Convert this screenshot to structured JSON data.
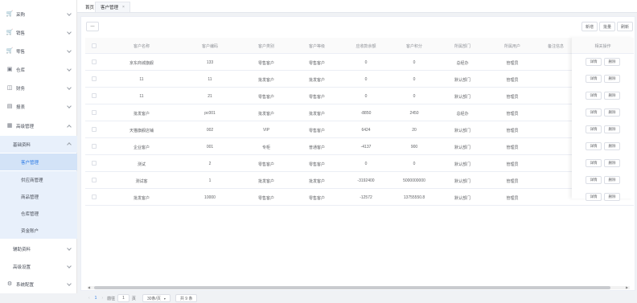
{
  "sidebar": {
    "items": [
      {
        "label": "采购",
        "icon": "cart-icon"
      },
      {
        "label": "销售",
        "icon": "cart-icon"
      },
      {
        "label": "零售",
        "icon": "cart-icon"
      },
      {
        "label": "仓库",
        "icon": "box-icon"
      },
      {
        "label": "财务",
        "icon": "finance-icon"
      },
      {
        "label": "报表",
        "icon": "report-icon"
      },
      {
        "label": "高级管理",
        "icon": "grid-icon"
      }
    ],
    "group": {
      "label": "基础资料"
    },
    "sub_items": [
      "客户管理",
      "供应商管理",
      "商品管理",
      "仓库管理",
      "资金账户"
    ],
    "bottom_items": [
      "辅助资料",
      "高级设置"
    ],
    "system": {
      "label": "系统配置"
    }
  },
  "tabs": {
    "home": "首页",
    "active": "客户管理",
    "close": "×"
  },
  "toolbar": {
    "collapse": "—",
    "add": "新增",
    "batch": "批量",
    "refresh": "刷新"
  },
  "table": {
    "headers": [
      "客户名称",
      "客户编码",
      "客户类别",
      "客户等级",
      "应收款余额",
      "客户积分",
      "所属部门",
      "所属用户",
      "备注信息",
      "相关操作"
    ],
    "rows": [
      [
        "京东商城旗舰",
        "133",
        "零售客户",
        "零售客户",
        "0",
        "0",
        "总经办",
        "管理员"
      ],
      [
        "11",
        "11",
        "批发客户",
        "批发客户",
        "0",
        "0",
        "默认部门",
        "管理员"
      ],
      [
        "11",
        "21",
        "零售客户",
        "零售客户",
        "0",
        "0",
        "默认部门",
        "管理员"
      ],
      [
        "批发客户",
        "pc001",
        "批发客户",
        "批发客户",
        "-8850",
        "2450",
        "总经办",
        "管理员"
      ],
      [
        "天猫旗舰店铺",
        "002",
        "VIP",
        "零售客户",
        "6424",
        "20",
        "默认部门",
        "管理员"
      ],
      [
        "企业客户",
        "001",
        "专柜",
        "普通客户",
        "-4137",
        "900",
        "默认部门",
        "管理员"
      ],
      [
        "测试",
        "2",
        "零售客户",
        "零售客户",
        "0",
        "0",
        "默认部门",
        "管理员"
      ],
      [
        "测试客",
        "1",
        "批发客户",
        "批发客户",
        "-3192400",
        "5000000000",
        "默认部门",
        "管理员"
      ],
      [
        "批发客户",
        "10000",
        "零售客户",
        "零售客户",
        "-12572",
        "13755550.8",
        "默认部门",
        "管理员"
      ]
    ],
    "action_detail": "详情",
    "action_delete": "删除"
  },
  "pager": {
    "prev": "‹",
    "page": "1",
    "next": "›",
    "goto": "前往",
    "page_input": "1",
    "page_unit": "页",
    "size": "30条/页",
    "total": "共 9 条"
  }
}
